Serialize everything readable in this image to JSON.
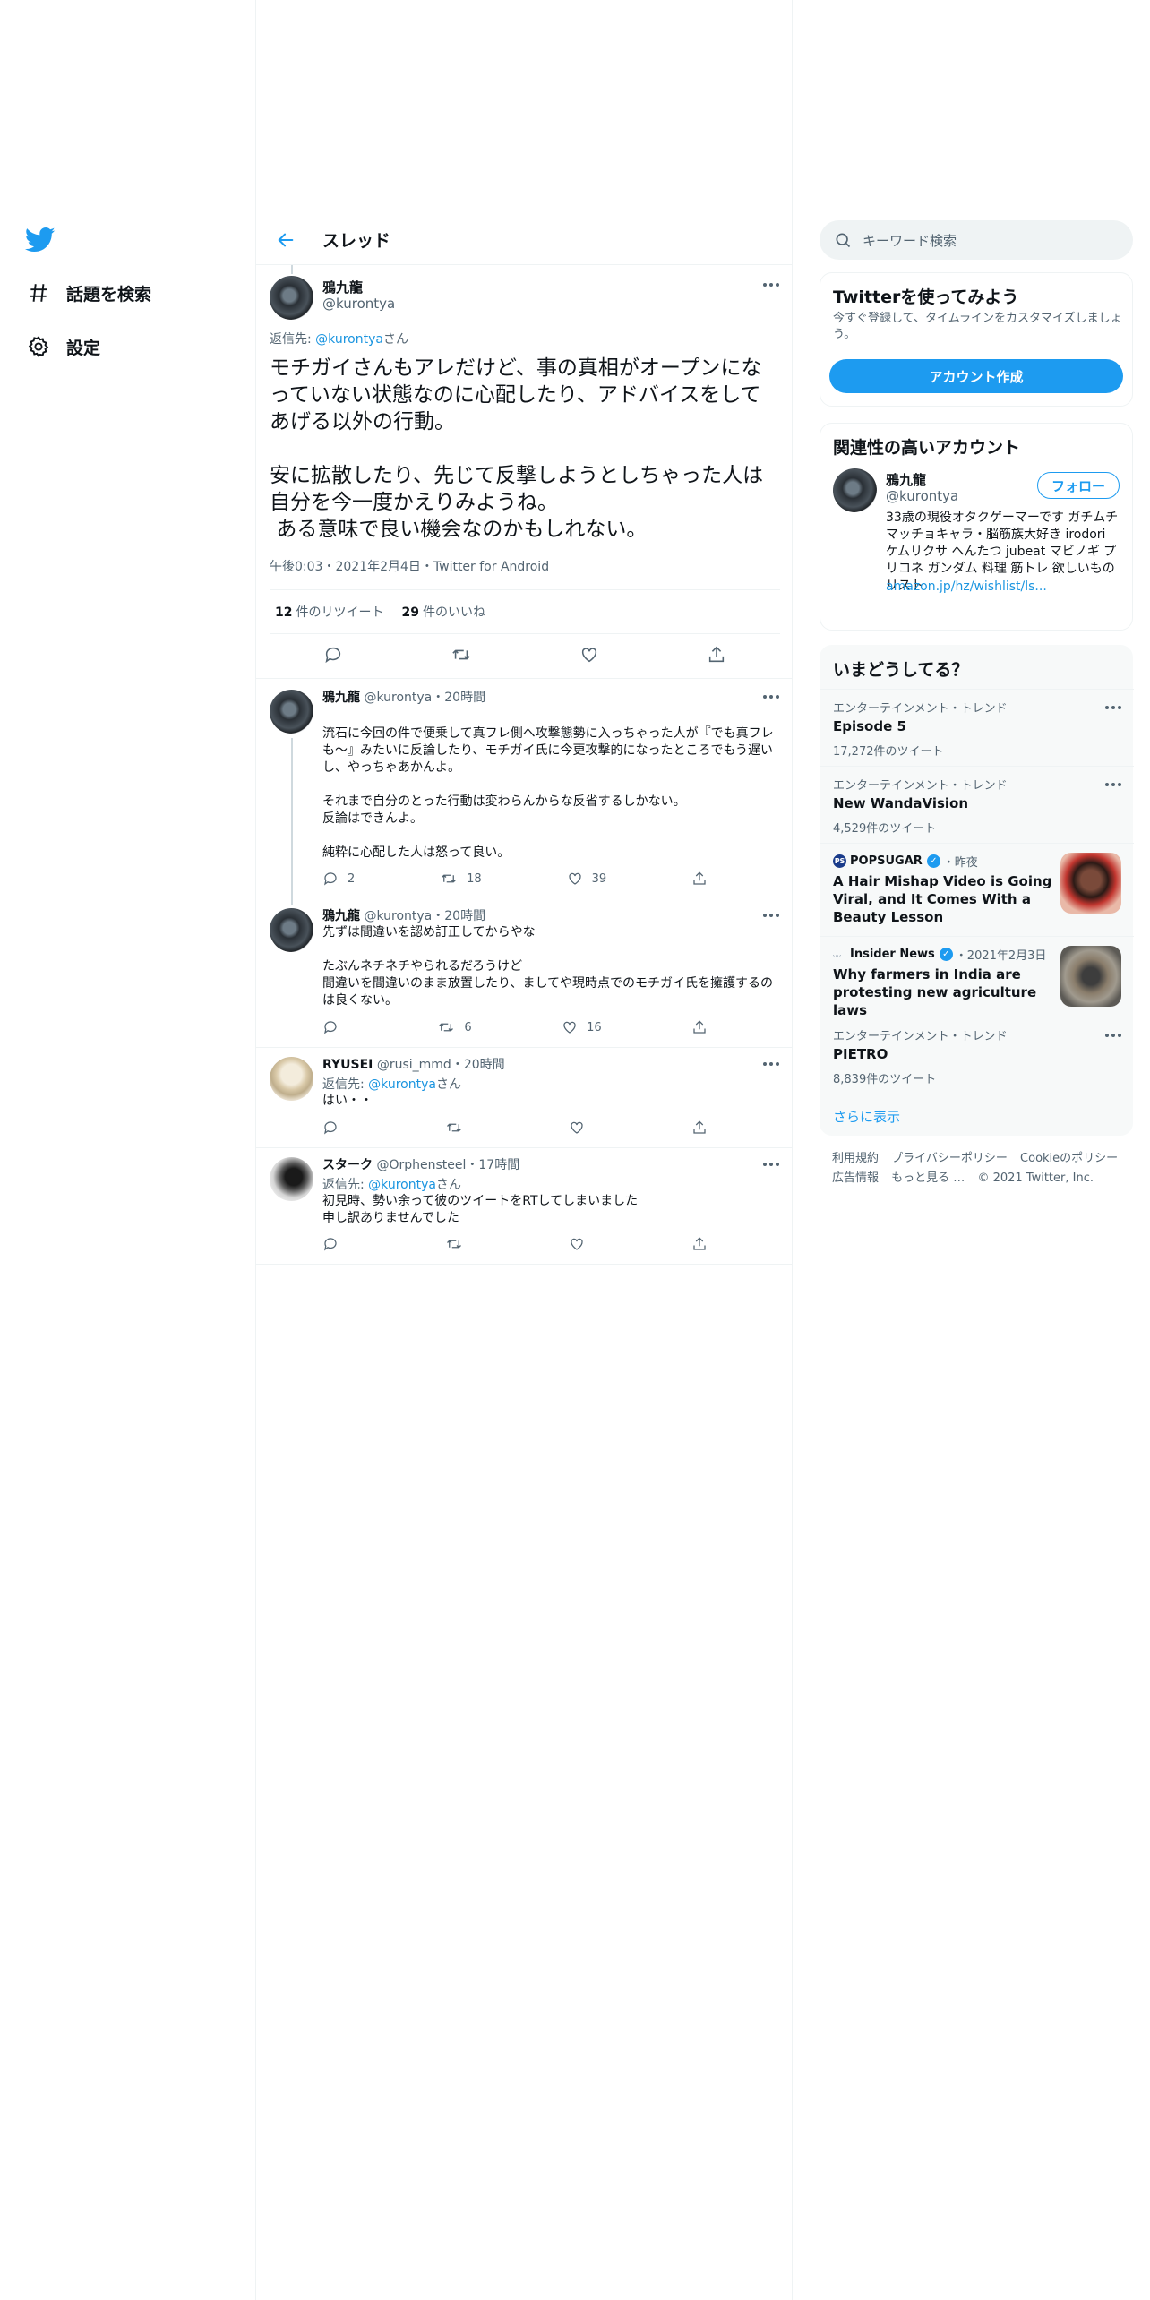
{
  "nav": {
    "items": [
      {
        "label": "話題を検索",
        "icon": "hashtag-icon"
      },
      {
        "label": "設定",
        "icon": "gear-icon"
      }
    ]
  },
  "header": {
    "title": "スレッド"
  },
  "main_tweet": {
    "name": "鴉九龍",
    "handle": "@kurontya",
    "reply_prefix": "返信先: ",
    "reply_to": "@kurontya",
    "reply_suffix": "さん",
    "text": "モチガイさんもアレだけど、事の真相がオープンになっていない状態なのに心配したり、アドバイスをしてあげる以外の行動。\n\n安に拡散したり、先じて反撃しようとしちゃった人は自分を今一度かえりみようね。\n ある意味で良い機会なのかもしれない。",
    "meta": "午後0:03・2021年2月4日・Twitter for Android",
    "retweets": "12",
    "retweets_label": "件のリツイート",
    "likes": "29",
    "likes_label": "件のいいね"
  },
  "replies": [
    {
      "name": "鴉九龍",
      "handle": "@kurontya",
      "time": "20時間",
      "reply_to": "",
      "text": "流石に今回の件で便乗して真フレ側へ攻撃態勢に入っちゃった人が『でも真フレも～』みたいに反論したり、モチガイ氏に今更攻撃的になったところでもう遅いし、やっちゃあかんよ。\n\nそれまで自分のとった行動は変わらんからな反省するしかない。\n反論はできんよ。\n\n純粋に心配した人は怒って良い。",
      "replies": "2",
      "retweets": "18",
      "likes": "39"
    },
    {
      "name": "鴉九龍",
      "handle": "@kurontya",
      "time": "20時間",
      "reply_to": "",
      "text": "先ずは間違いを認め訂正してからやな\n\nたぶんネチネチやられるだろうけど\n間違いを間違いのまま放置したり、ましてや現時点でのモチガイ氏を擁護するのは良くない。",
      "replies": "",
      "retweets": "6",
      "likes": "16"
    },
    {
      "name": "RYUSEI",
      "handle": "@rusi_mmd",
      "time": "20時間",
      "reply_to": "@kurontya",
      "text": "はい・・",
      "replies": "",
      "retweets": "",
      "likes": ""
    },
    {
      "name": "スターク",
      "handle": "@Orphensteel",
      "time": "17時間",
      "reply_to": "@kurontya",
      "text": "初見時、勢い余って彼のツイートをRTしてしまいました\n申し訳ありませんでした",
      "replies": "",
      "retweets": "",
      "likes": ""
    }
  ],
  "reply_labels": {
    "prefix": "返信先: ",
    "suffix": "さん",
    "dot": "・"
  },
  "search": {
    "placeholder": "キーワード検索"
  },
  "signup": {
    "title": "Twitterを使ってみよう",
    "subtitle": "今すぐ登録して、タイムラインをカスタマイズしましょう。",
    "button": "アカウント作成"
  },
  "related": {
    "title": "関連性の高いアカウント",
    "name": "鴉九龍",
    "handle": "@kurontya",
    "follow": "フォロー",
    "bio": "33歳の現役オタクゲーマーです ガチムチマッチョキャラ・脳筋族大好き irodori ケムリクサ へんたつ jubeat マビノギ プリコネ ガンダム 料理 筋トレ 欲しいものリスト",
    "link": "amazon.jp/hz/wishlist/ls..."
  },
  "trends": {
    "title": "いまどうしてる？",
    "items": [
      {
        "context": "エンターテインメント・トレンド",
        "title": "Episode 5",
        "count": "17,272件のツイート"
      },
      {
        "context": "エンターテインメント・トレンド",
        "title": "New WandaVision",
        "count": "4,529件のツイート"
      },
      {
        "source": "POPSUGAR",
        "time": "・昨夜",
        "headline": "A Hair Mishap Video is Going Viral, and It Comes With a Beauty Lesson"
      },
      {
        "source": "Insider News",
        "time": "・2021年2月3日",
        "headline": "Why farmers in India are protesting new agriculture laws"
      },
      {
        "context": "エンターテインメント・トレンド",
        "title": "PIETRO",
        "count": "8,839件のツイート"
      }
    ],
    "more": "さらに表示"
  },
  "footer": {
    "links": [
      "利用規約",
      "プライバシーポリシー",
      "Cookieのポリシー",
      "広告情報",
      "もっと見る …",
      "© 2021 Twitter, Inc."
    ]
  },
  "colors": {
    "accent": "#1d9bf0",
    "text": "#0f1419",
    "secondary": "#536471",
    "border": "#eff3f4"
  }
}
